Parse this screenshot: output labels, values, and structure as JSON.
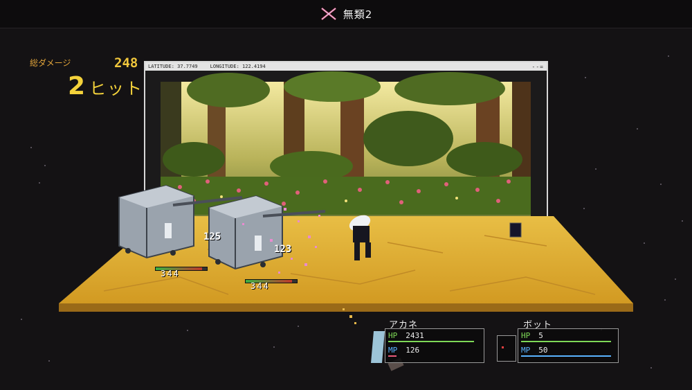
{
  "header": {
    "title": "無類2",
    "icon": "crossed-swords-icon"
  },
  "damage": {
    "label": "総ダメージ",
    "total": "248",
    "hit_count": "2",
    "hit_label": "ヒット！"
  },
  "window": {
    "latitude": "LATITUDE: 37.7749",
    "longitude": "LONGITUDE: 122.4194",
    "controls": "--="
  },
  "enemies": [
    {
      "damage": "125",
      "hp": "344",
      "hp_fraction": 0.9
    },
    {
      "damage": "123",
      "hp": "344",
      "hp_fraction": 0.9
    }
  ],
  "party": [
    {
      "name": "アカネ",
      "hp_label": "HP",
      "hp": "2431",
      "mp_label": "MP",
      "mp": "126",
      "hp_fraction": 1.0,
      "mp_fraction": 0.1
    },
    {
      "name": "ボット",
      "hp_label": "HP",
      "hp": "5",
      "mp_label": "MP",
      "mp": "50",
      "hp_fraction": 1.0,
      "mp_fraction": 1.0
    }
  ],
  "colors": {
    "accent": "#f4d23b",
    "hp": "#7ed957",
    "mp": "#5ab3ff",
    "floor": "#e0b53a"
  }
}
